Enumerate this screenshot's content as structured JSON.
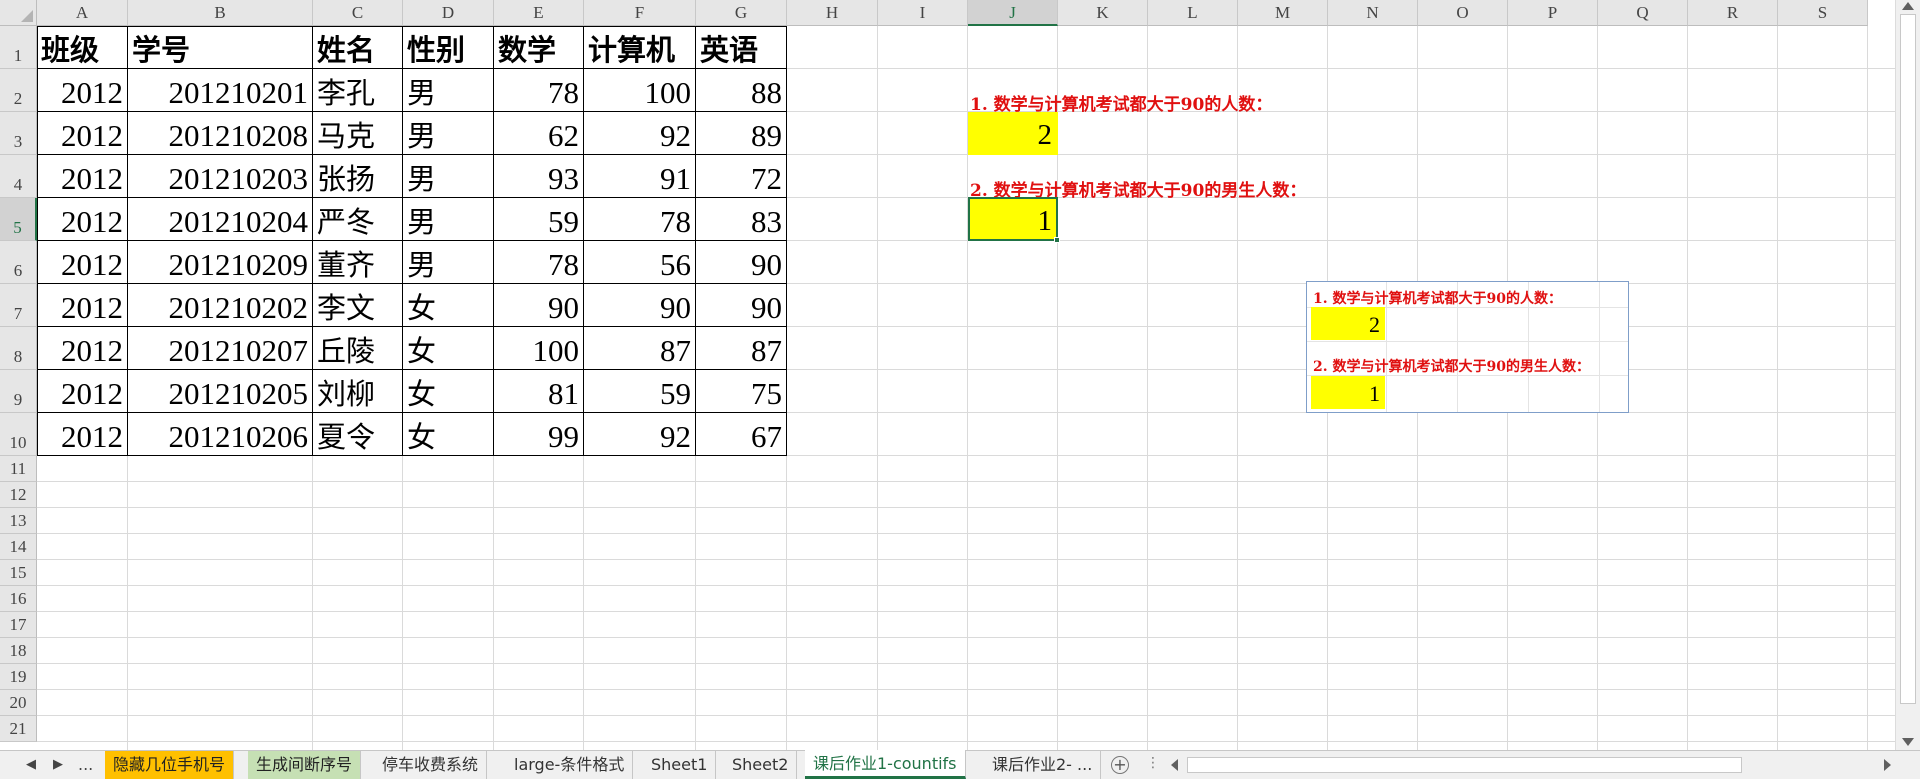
{
  "columns": [
    "A",
    "B",
    "C",
    "D",
    "E",
    "F",
    "G",
    "H",
    "I",
    "J",
    "K",
    "L",
    "M",
    "N",
    "O",
    "P",
    "Q",
    "R",
    "S"
  ],
  "rows": [
    "1",
    "2",
    "3",
    "4",
    "5",
    "6",
    "7",
    "8",
    "9",
    "10",
    "11",
    "12",
    "13",
    "14",
    "15",
    "16",
    "17",
    "18",
    "19",
    "20",
    "21"
  ],
  "selected_column": "J",
  "selected_row": "5",
  "table": {
    "headers": [
      "班级",
      "学号",
      "姓名",
      "性别",
      "数学",
      "计算机",
      "英语"
    ],
    "records": [
      [
        "2012",
        "201210201",
        "李孔",
        "男",
        "78",
        "100",
        "88"
      ],
      [
        "2012",
        "201210208",
        "马克",
        "男",
        "62",
        "92",
        "89"
      ],
      [
        "2012",
        "201210203",
        "张扬",
        "男",
        "93",
        "91",
        "72"
      ],
      [
        "2012",
        "201210204",
        "严冬",
        "男",
        "59",
        "78",
        "83"
      ],
      [
        "2012",
        "201210209",
        "董齐",
        "男",
        "78",
        "56",
        "90"
      ],
      [
        "2012",
        "201210202",
        "李文",
        "女",
        "90",
        "90",
        "90"
      ],
      [
        "2012",
        "201210207",
        "丘陵",
        "女",
        "100",
        "87",
        "87"
      ],
      [
        "2012",
        "201210205",
        "刘柳",
        "女",
        "81",
        "59",
        "75"
      ],
      [
        "2012",
        "201210206",
        "夏令",
        "女",
        "99",
        "92",
        "67"
      ]
    ]
  },
  "questions": {
    "q1": "1. 数学与计算机考试都大于90的人数：",
    "a1": "2",
    "q2": "2. 数学与计算机考试都大于90的男生人数：",
    "a2": "1"
  },
  "picture": {
    "q1": "1. 数学与计算机考试都大于90的人数：",
    "a1": "2",
    "q2": "2. 数学与计算机考试都大于90的男生人数：",
    "a2": "1"
  },
  "tabs": {
    "ellipsis": "...",
    "items": [
      {
        "label": "隐藏几位手机号",
        "color": "#ffc000"
      },
      {
        "label": "生成间断序号",
        "color": "#c6e0b4"
      },
      {
        "label": "停车收费系统",
        "color": ""
      },
      {
        "label": "large-条件格式",
        "color": ""
      },
      {
        "label": "Sheet1",
        "color": ""
      },
      {
        "label": "Sheet2",
        "color": ""
      },
      {
        "label": "课后作业1-countifs",
        "color": "",
        "active": true
      },
      {
        "label": "课后作业2- ...",
        "color": ""
      }
    ],
    "add_symbol": "+",
    "more_symbol": "⋮"
  },
  "colors": {
    "accent": "#217346",
    "highlight": "#ffff00",
    "question_text": "#e01010"
  }
}
